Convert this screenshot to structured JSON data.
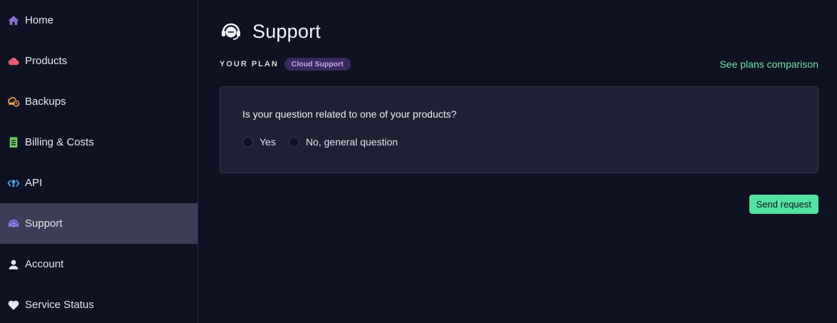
{
  "sidebar": {
    "items": [
      {
        "label": "Home",
        "icon": "home-icon",
        "active": false
      },
      {
        "label": "Products",
        "icon": "cloud-icon",
        "active": false
      },
      {
        "label": "Backups",
        "icon": "backup-icon",
        "active": false
      },
      {
        "label": "Billing & Costs",
        "icon": "receipt-icon",
        "active": false
      },
      {
        "label": "API",
        "icon": "api-icon",
        "active": false
      },
      {
        "label": "Support",
        "icon": "support-agent-icon",
        "active": true
      },
      {
        "label": "Account",
        "icon": "person-icon",
        "active": false
      },
      {
        "label": "Service Status",
        "icon": "heart-icon",
        "active": false
      }
    ]
  },
  "header": {
    "title": "Support",
    "icon": "support-agent-icon"
  },
  "plan": {
    "label": "YOUR PLAN",
    "badge": "Cloud Support",
    "comparison_link": "See plans comparison"
  },
  "question": {
    "text": "Is your question related to one of your products?",
    "options": [
      "Yes",
      "No, general question"
    ]
  },
  "actions": {
    "send_label": "Send request"
  },
  "colors": {
    "background": "#0f1222",
    "sidebar_active": "#3c3d57",
    "card": "#1e2034",
    "accent_green": "#52e3a0",
    "link_green": "#6ee7a8",
    "badge_bg": "#3a2a5e",
    "badge_text": "#c9a8f2",
    "home_icon": "#8b6fd6",
    "cloud_icon": "#e85d75",
    "backup_icon": "#f0a050",
    "receipt_icon": "#6fcf5f",
    "api_icon": "#4aa3f0",
    "support_icon": "#8b7ff0"
  }
}
